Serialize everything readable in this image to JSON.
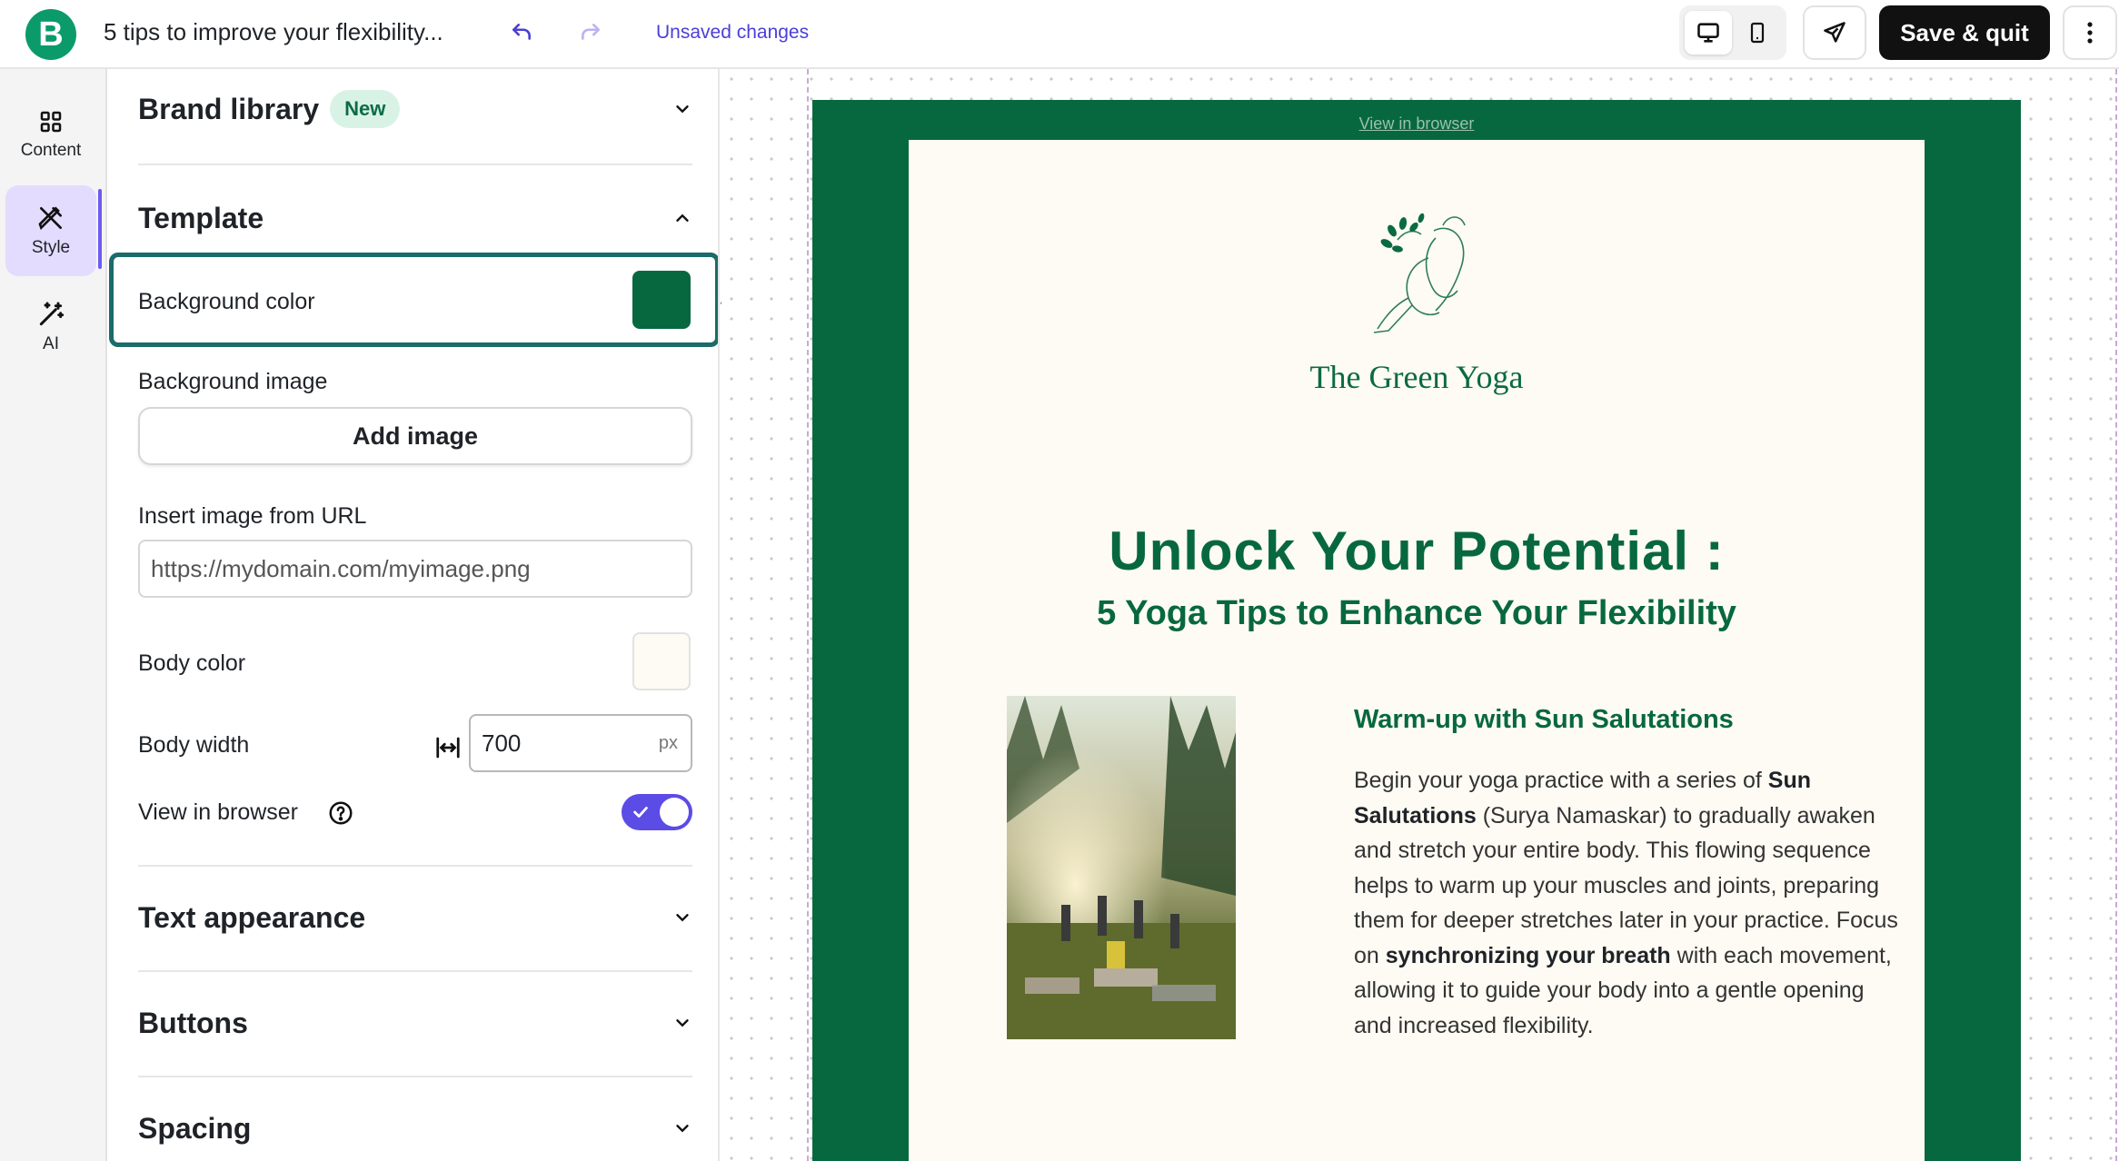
{
  "app": {
    "doc_title": "5 tips to improve your flexibility...",
    "status": "Unsaved changes",
    "save_label": "Save & quit"
  },
  "rail": {
    "items": [
      {
        "label": "Content",
        "icon": "grid-icon"
      },
      {
        "label": "Style",
        "icon": "style-pen-icon",
        "active": true
      },
      {
        "label": "AI",
        "icon": "magic-wand-icon"
      }
    ]
  },
  "panel": {
    "brand_library": {
      "title": "Brand library",
      "badge": "New"
    },
    "template": {
      "title": "Template",
      "background_color_label": "Background color",
      "background_color": "#07683f",
      "background_image_label": "Background image",
      "add_image_label": "Add image",
      "insert_url_label": "Insert image from URL",
      "url_placeholder": "https://mydomain.com/myimage.png",
      "body_color_label": "Body color",
      "body_color": "#fdfbf3",
      "body_width_label": "Body width",
      "body_width_value": "700",
      "body_width_unit": "px",
      "view_in_browser_label": "View in browser",
      "view_in_browser_on": true
    },
    "text_appearance": {
      "title": "Text appearance"
    },
    "buttons": {
      "title": "Buttons"
    },
    "spacing": {
      "title": "Spacing"
    }
  },
  "email": {
    "view_in_browser": "View in browser",
    "brand_name": "The Green Yoga",
    "headline": "Unlock Your Potential :",
    "subheadline": "5 Yoga Tips to Enhance Your Flexibility",
    "tip_title": "Warm-up with Sun Salutations",
    "tip_text_1": "Begin your yoga practice with a series of ",
    "tip_bold_1": "Sun Salutations",
    "tip_text_2": " (Surya Namaskar) to gradually awaken and stretch your entire body. This flowing sequence helps to warm up your muscles and joints, preparing them for deeper stretches later in your practice. Focus on ",
    "tip_bold_2": "synchronizing your breath",
    "tip_text_3": " with each movement, allowing it to guide your body into a gentle opening and increased flexibility."
  },
  "colors": {
    "accent": "#5b4ce6",
    "brand_green": "#07683f",
    "highlight": "#1b6b6a"
  }
}
